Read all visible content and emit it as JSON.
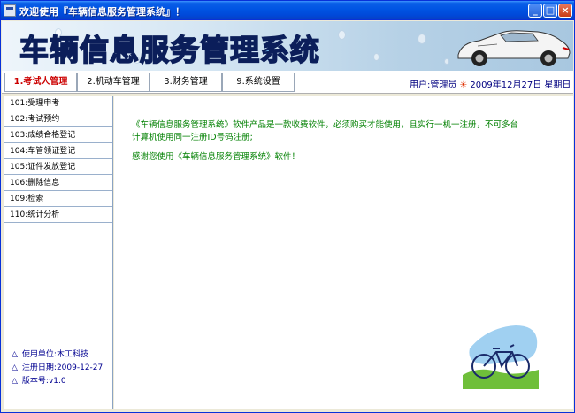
{
  "window": {
    "title": "欢迎使用『车辆信息服务管理系统』！"
  },
  "banner": {
    "title": "车辆信息服务管理系统"
  },
  "menu": {
    "tabs": [
      {
        "label": "1.考试人管理",
        "active": true
      },
      {
        "label": "2.机动车管理",
        "active": false
      },
      {
        "label": "3.财务管理",
        "active": false
      },
      {
        "label": "9.系统设置",
        "active": false
      }
    ]
  },
  "status": {
    "user_label": "用户:管理员",
    "date": "2009年12月27日 星期日"
  },
  "sidebar": {
    "items": [
      {
        "label": "101:受理申考"
      },
      {
        "label": "102:考试预约"
      },
      {
        "label": "103:成绩合格登记"
      },
      {
        "label": "104:车管领证登记"
      },
      {
        "label": "105:证件发放登记"
      },
      {
        "label": "106:删除信息"
      },
      {
        "label": "109:检索"
      },
      {
        "label": "110:统计分析"
      }
    ],
    "info": {
      "unit": "使用单位:木工科技",
      "register_date": "注册日期:2009-12-27",
      "version": "版本号:v1.0"
    }
  },
  "content": {
    "line1": "《车辆信息服务管理系统》软件产品是一款收费软件，必须购买才能使用，且实行一机一注册，不可多台",
    "line2": "计算机使用同一注册ID号码注册;",
    "line3": "感谢您使用《车辆信息服务管理系统》软件！"
  },
  "colors": {
    "titlebar": "#0054e3",
    "active_tab": "#cc0000",
    "message_text": "#008000",
    "info_text": "#000090"
  }
}
